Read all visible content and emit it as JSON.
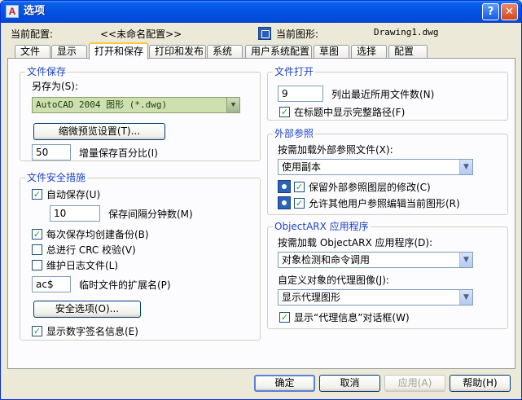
{
  "window": {
    "app_icon": "A",
    "title": "选项",
    "help_glyph": "?",
    "close_glyph": "✕"
  },
  "profile": {
    "current_profile_label": "当前配置:",
    "current_profile_value": "<<未命名配置>>",
    "current_drawing_label": "当前图形:",
    "current_drawing_value": "Drawing1.dwg"
  },
  "tabs": [
    {
      "label": "文件",
      "active": false
    },
    {
      "label": "显示",
      "active": false
    },
    {
      "label": "打开和保存",
      "active": true
    },
    {
      "label": "打印和发布",
      "active": false
    },
    {
      "label": "系统",
      "active": false
    },
    {
      "label": "用户系统配置",
      "active": false
    },
    {
      "label": "草图",
      "active": false
    },
    {
      "label": "选择",
      "active": false
    },
    {
      "label": "配置",
      "active": false
    }
  ],
  "file_save": {
    "legend": "文件保存",
    "save_as_label": "另存为(S):",
    "save_as_value": "AutoCAD 2004 图形 (*.dwg)",
    "thumbnail_button": "缩微预览设置(T)...",
    "incremental_value": "50",
    "incremental_label": "增量保存百分比(I)"
  },
  "file_safety": {
    "legend": "文件安全措施",
    "autosave_label": "自动保存(U)",
    "autosave_checked": true,
    "interval_value": "10",
    "interval_label": "保存间隔分钟数(M)",
    "backup_label": "每次保存均创建备份(B)",
    "backup_checked": true,
    "crc_label": "总进行 CRC 校验(V)",
    "crc_checked": false,
    "log_label": "维护日志文件(L)",
    "log_checked": false,
    "temp_ext_value": "ac$",
    "temp_ext_label": "临时文件的扩展名(P)",
    "security_button": "安全选项(O)...",
    "digsig_label": "显示数字签名信息(E)",
    "digsig_checked": true
  },
  "file_open": {
    "legend": "文件打开",
    "recent_value": "9",
    "recent_label": "列出最近所用文件数(N)",
    "fullpath_label": "在标题中显示完整路径(F)",
    "fullpath_checked": true
  },
  "xref": {
    "legend": "外部参照",
    "demand_load_label": "按需加载外部参照文件(X):",
    "demand_load_value": "使用副本",
    "retain_label": "保留外部参照图层的修改(C)",
    "retain_checked": true,
    "allow_edit_label": "允许其他用户参照编辑当前图形(R)",
    "allow_edit_checked": true
  },
  "objectarx": {
    "legend": "ObjectARX 应用程序",
    "demand_load_label": "按需加载 ObjectARX 应用程序(D):",
    "demand_load_value": "对象检测和命令调用",
    "proxy_label": "自定义对象的代理图像(J):",
    "proxy_value": "显示代理图形",
    "proxy_info_label": "显示“代理信息”对话框(W)",
    "proxy_info_checked": true
  },
  "footer": {
    "ok": "确定",
    "cancel": "取消",
    "apply": "应用(A)",
    "help": "帮助(H)"
  },
  "colors": {
    "titlebar": "#0453e4",
    "legend_text": "#1f44c4",
    "save_as_highlight": "#cfe0b0",
    "annotation_stroke": "#e8121a",
    "check_mark": "#21a121"
  }
}
